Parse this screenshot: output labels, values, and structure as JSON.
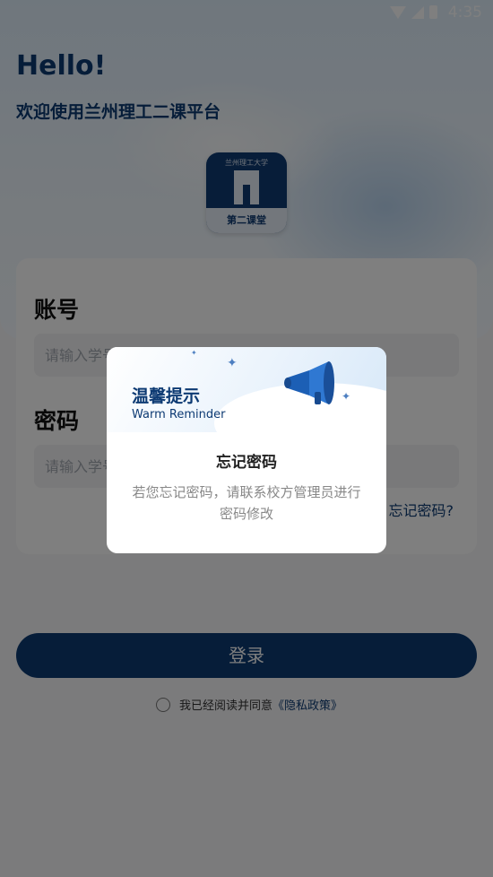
{
  "status": {
    "time": "4:35"
  },
  "hero": {
    "greeting": "Hello!",
    "welcome": "欢迎使用兰州理工二课平台"
  },
  "logo": {
    "top_text": "兰州理工大学",
    "band_text": "第二课堂"
  },
  "form": {
    "account_label": "账号",
    "account_placeholder": "请输入学号",
    "password_label": "密码",
    "password_placeholder": "请输入学号",
    "forgot_label": "忘记密码?"
  },
  "login": {
    "button_label": "登录"
  },
  "agreement": {
    "prefix": "我已经阅读并同意",
    "link": "《隐私政策》"
  },
  "dialog": {
    "title": "温馨提示",
    "subtitle": "Warm Reminder",
    "heading": "忘记密码",
    "message": "若您忘记密码，请联系校方管理员进行密码修改"
  },
  "colors": {
    "brand": "#0d3a73",
    "overlay": "rgba(0,0,0,0.5)"
  },
  "icons": [
    "wifi-icon",
    "signal-icon",
    "battery-icon",
    "megaphone-icon"
  ]
}
